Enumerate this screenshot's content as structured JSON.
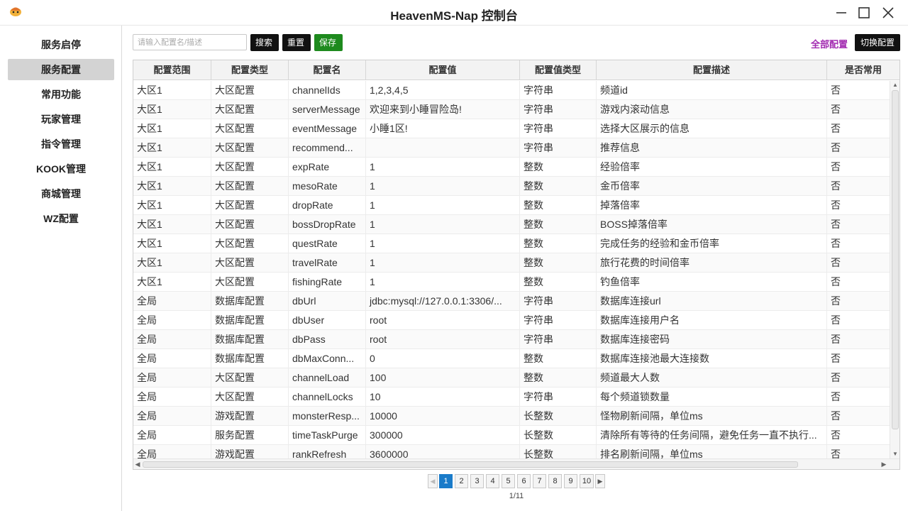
{
  "window": {
    "title": "HeavenMS-Nap 控制台"
  },
  "sidebar": {
    "items": [
      {
        "label": "服务启停",
        "active": false
      },
      {
        "label": "服务配置",
        "active": true
      },
      {
        "label": "常用功能",
        "active": false
      },
      {
        "label": "玩家管理",
        "active": false
      },
      {
        "label": "指令管理",
        "active": false
      },
      {
        "label": "KOOK管理",
        "active": false
      },
      {
        "label": "商城管理",
        "active": false
      },
      {
        "label": "WZ配置",
        "active": false
      }
    ]
  },
  "toolbar": {
    "search_placeholder": "请输入配置名/描述",
    "search_value": "",
    "search_label": "搜索",
    "reset_label": "重置",
    "save_label": "保存",
    "all_config_label": "全部配置",
    "switch_label": "切换配置"
  },
  "table": {
    "columns": [
      "配置范围",
      "配置类型",
      "配置名",
      "配置值",
      "配置值类型",
      "配置描述",
      "是否常用"
    ],
    "rows": [
      [
        "大区1",
        "大区配置",
        "channelIds",
        "1,2,3,4,5",
        "字符串",
        "频道id",
        "否"
      ],
      [
        "大区1",
        "大区配置",
        "serverMessage",
        "欢迎来到小睡冒险岛!",
        "字符串",
        "游戏内滚动信息",
        "否"
      ],
      [
        "大区1",
        "大区配置",
        "eventMessage",
        "小睡1区!",
        "字符串",
        "选择大区展示的信息",
        "否"
      ],
      [
        "大区1",
        "大区配置",
        "recommend...",
        "",
        "字符串",
        "推荐信息",
        "否"
      ],
      [
        "大区1",
        "大区配置",
        "expRate",
        "1",
        "整数",
        "经验倍率",
        "否"
      ],
      [
        "大区1",
        "大区配置",
        "mesoRate",
        "1",
        "整数",
        "金币倍率",
        "否"
      ],
      [
        "大区1",
        "大区配置",
        "dropRate",
        "1",
        "整数",
        "掉落倍率",
        "否"
      ],
      [
        "大区1",
        "大区配置",
        "bossDropRate",
        "1",
        "整数",
        "BOSS掉落倍率",
        "否"
      ],
      [
        "大区1",
        "大区配置",
        "questRate",
        "1",
        "整数",
        "完成任务的经验和金币倍率",
        "否"
      ],
      [
        "大区1",
        "大区配置",
        "travelRate",
        "1",
        "整数",
        "旅行花费的时间倍率",
        "否"
      ],
      [
        "大区1",
        "大区配置",
        "fishingRate",
        "1",
        "整数",
        "钓鱼倍率",
        "否"
      ],
      [
        "全局",
        "数据库配置",
        "dbUrl",
        "jdbc:mysql://127.0.0.1:3306/...",
        "字符串",
        "数据库连接url",
        "否"
      ],
      [
        "全局",
        "数据库配置",
        "dbUser",
        "root",
        "字符串",
        "数据库连接用户名",
        "否"
      ],
      [
        "全局",
        "数据库配置",
        "dbPass",
        "root",
        "字符串",
        "数据库连接密码",
        "否"
      ],
      [
        "全局",
        "数据库配置",
        "dbMaxConn...",
        "0",
        "整数",
        "数据库连接池最大连接数",
        "否"
      ],
      [
        "全局",
        "大区配置",
        "channelLoad",
        "100",
        "整数",
        "频道最大人数",
        "否"
      ],
      [
        "全局",
        "大区配置",
        "channelLocks",
        "10",
        "字符串",
        "每个频道锁数量",
        "否"
      ],
      [
        "全局",
        "游戏配置",
        "monsterResp...",
        "10000",
        "长整数",
        "怪物刷新间隔，单位ms",
        "否"
      ],
      [
        "全局",
        "服务配置",
        "timeTaskPurge",
        "300000",
        "长整数",
        "清除所有等待的任务间隔，避免任务一直不执行...",
        "否"
      ],
      [
        "全局",
        "游戏配置",
        "rankRefresh",
        "3600000",
        "长整数",
        "排名刷新间隔，单位ms",
        "否"
      ]
    ]
  },
  "pagination": {
    "pages": [
      "1",
      "2",
      "3",
      "4",
      "5",
      "6",
      "7",
      "8",
      "9",
      "10"
    ],
    "current": "1",
    "info": "1/11"
  },
  "colors": {
    "accent": "#1a7bc9",
    "save": "#1e8a1e",
    "link": "#a22ab0",
    "sidebar_active": "#d3d3d3"
  }
}
